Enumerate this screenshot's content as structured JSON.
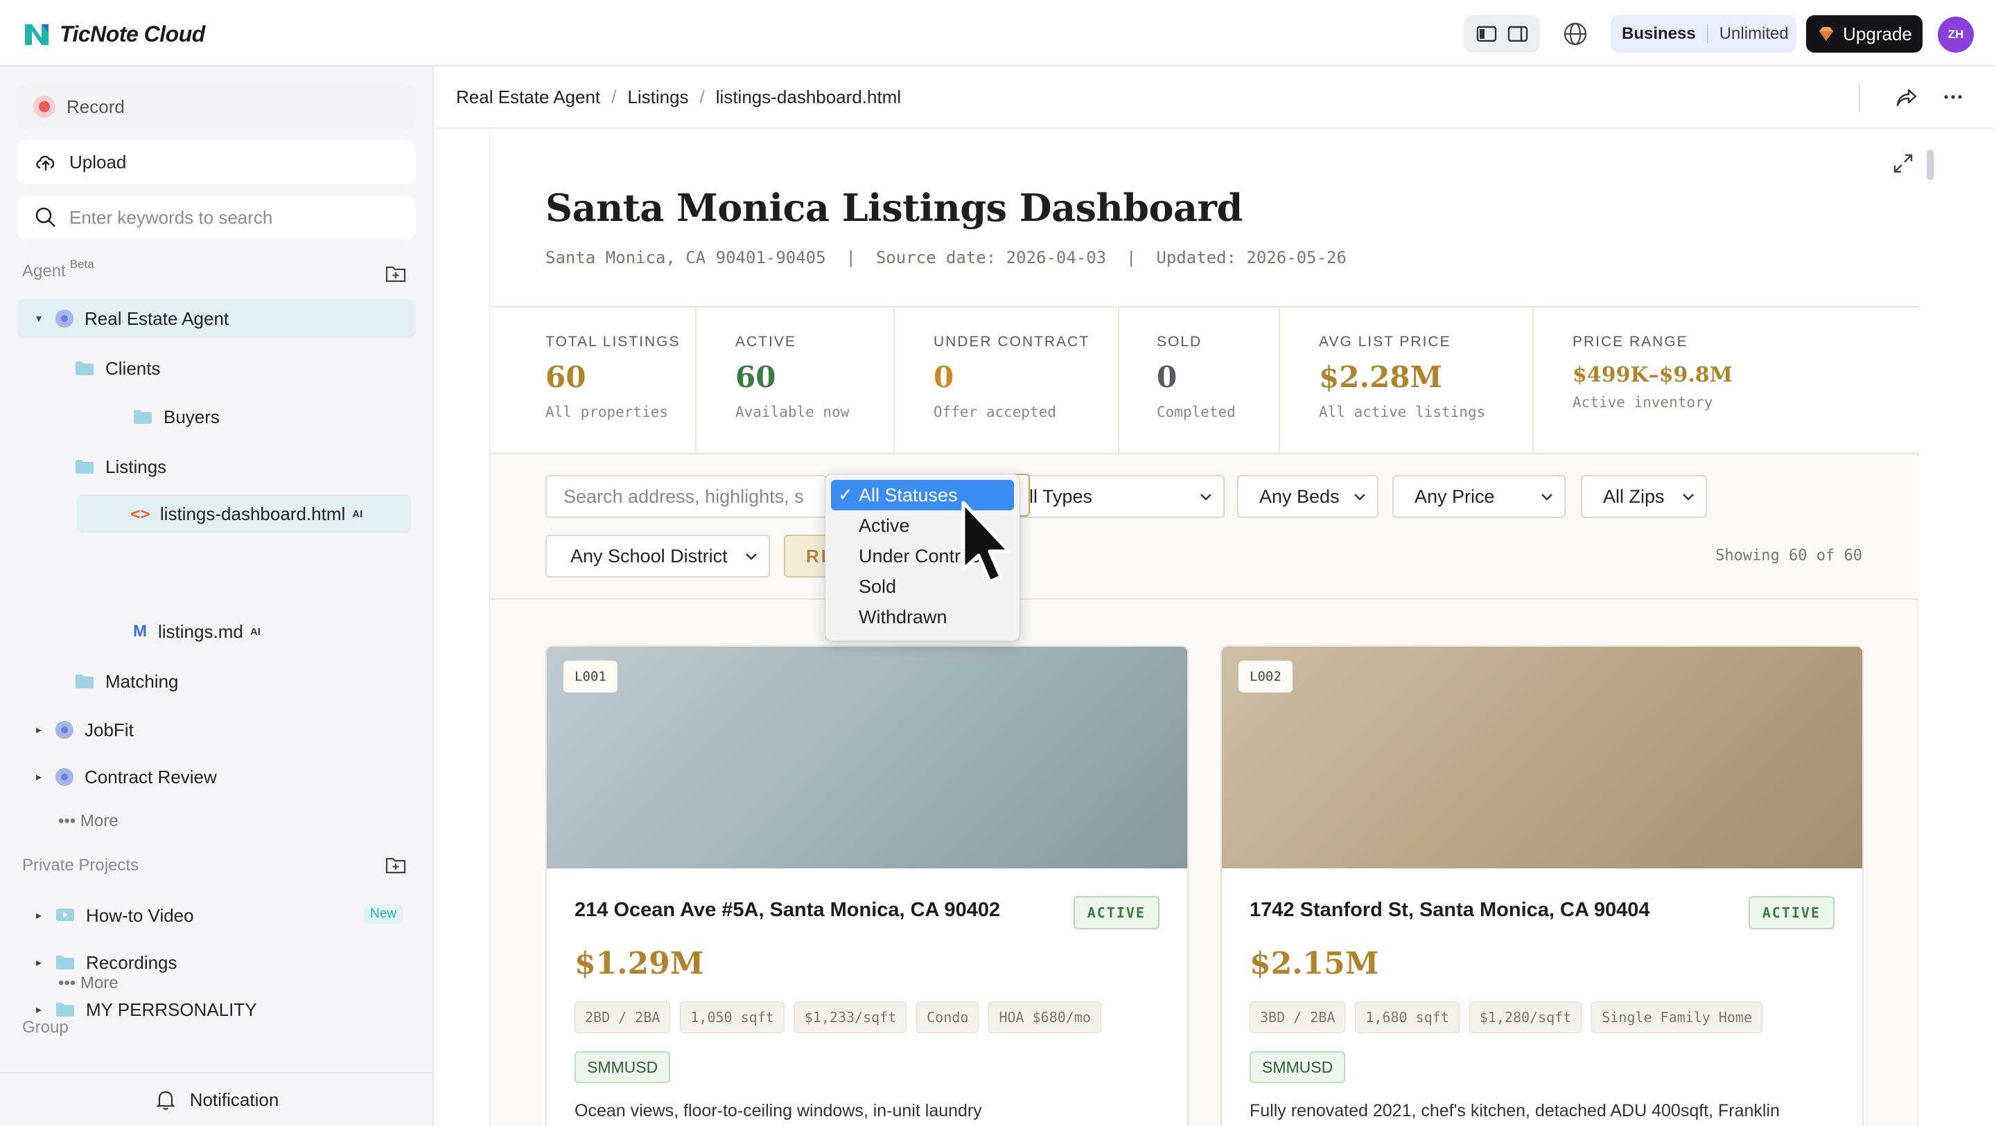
{
  "app": {
    "name": "TicNote Cloud",
    "plan": "Business",
    "plan_tier": "Unlimited",
    "upgrade_label": "Upgrade",
    "avatar_initials": "ZH"
  },
  "sidebar": {
    "record_label": "Record",
    "upload_label": "Upload",
    "search_placeholder": "Enter keywords to search",
    "agent_section": "Agent",
    "agent_badge": "Beta",
    "agents": {
      "real_estate": "Real Estate Agent",
      "clients": "Clients",
      "buyers": "Buyers",
      "listings": "Listings",
      "listings_dashboard": "listings-dashboard.html",
      "listings_md": "listings.md",
      "ai_badge": "AI",
      "matching": "Matching",
      "jobfit": "JobFit",
      "contract_review": "Contract Review"
    },
    "more_label": "More",
    "private_section": "Private Projects",
    "projects": {
      "howto": "How-to Video",
      "new_badge": "New",
      "recordings": "Recordings",
      "personality": "MY PERRSONALITY"
    },
    "group_section": "Group",
    "notification_label": "Notification"
  },
  "breadcrumb": {
    "items": [
      "Real Estate Agent",
      "Listings",
      "listings-dashboard.html"
    ]
  },
  "dashboard": {
    "title": "Santa Monica Listings Dashboard",
    "meta": "Santa Monica, CA 90401-90405  |  Source date: 2026-04-03  |  Updated: 2026-05-26",
    "stats": [
      {
        "label": "Total Listings",
        "value": "60",
        "sub": "All properties",
        "color": "#b0842c"
      },
      {
        "label": "Active",
        "value": "60",
        "sub": "Available now",
        "color": "#3c7a44"
      },
      {
        "label": "Under Contract",
        "value": "0",
        "sub": "Offer accepted",
        "color": "#c98a2a"
      },
      {
        "label": "Sold",
        "value": "0",
        "sub": "Completed",
        "color": "#5a5a60"
      },
      {
        "label": "Avg List Price",
        "value": "$2.28M",
        "sub": "All active listings",
        "color": "#b0842c"
      },
      {
        "label": "Price Range",
        "value": "$499K–$9.8M",
        "sub": "Active inventory",
        "color": "#b0842c"
      }
    ],
    "filters": {
      "search_placeholder": "Search address, highlights, s",
      "status_options": [
        "All Statuses",
        "Active",
        "Under Contract",
        "Sold",
        "Withdrawn"
      ],
      "status_selected": "All Statuses",
      "types": "All Types",
      "beds": "Any Beds",
      "price": "Any Price",
      "zips": "All Zips",
      "school": "Any School District",
      "reset": "RESET",
      "showing": "Showing 60 of 60"
    },
    "listings": [
      {
        "id": "L001",
        "address": "214 Ocean Ave #5A, Santa Monica, CA 90402",
        "status": "ACTIVE",
        "price": "$1.29M",
        "tags": [
          "2BD / 2BA",
          "1,050 sqft",
          "$1,233/sqft",
          "Condo",
          "HOA $680/mo"
        ],
        "district": "SMMUSD",
        "description": "Ocean views, floor-to-ceiling windows, in-unit laundry"
      },
      {
        "id": "L002",
        "address": "1742 Stanford St, Santa Monica, CA 90404",
        "status": "ACTIVE",
        "price": "$2.15M",
        "tags": [
          "3BD / 2BA",
          "1,680 sqft",
          "$1,280/sqft",
          "Single Family Home"
        ],
        "district": "SMMUSD",
        "description": "Fully renovated 2021, chef's kitchen, detached ADU 400sqft, Franklin"
      }
    ]
  }
}
